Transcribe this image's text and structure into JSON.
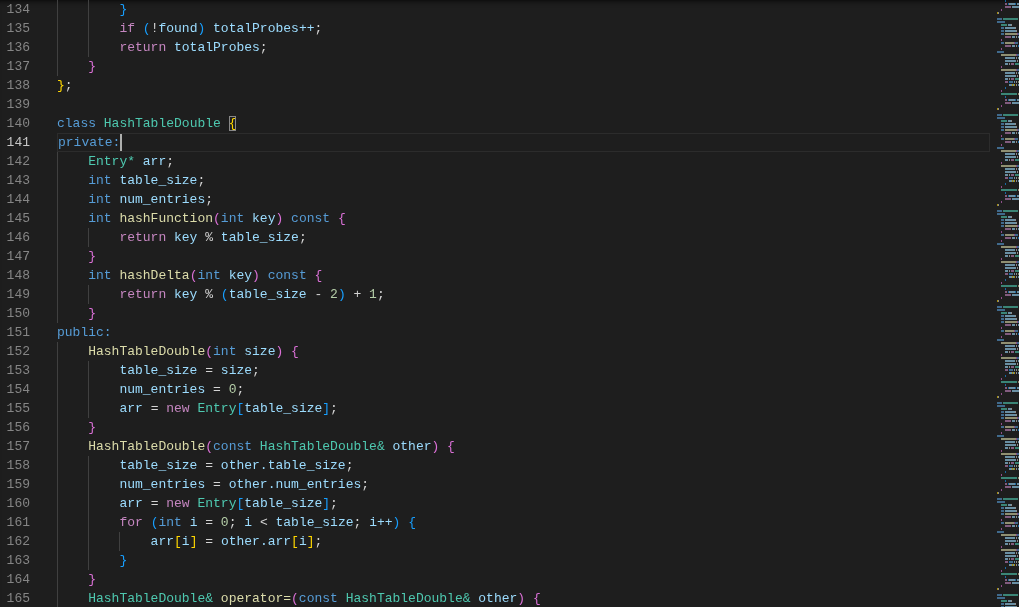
{
  "editor": {
    "lines": [
      {
        "number": "134",
        "current": false,
        "tokens": [
          {
            "text": "        }",
            "kind": "b3"
          }
        ]
      },
      {
        "number": "135",
        "current": false,
        "tokens": [
          {
            "text": "        if",
            "kind": "ctl"
          },
          {
            "text": " (",
            "kind": "b3"
          },
          {
            "text": "!",
            "kind": "plain"
          },
          {
            "text": "found",
            "kind": "var"
          },
          {
            "text": ")",
            "kind": "b3"
          },
          {
            "text": " totalProbes++",
            "kind": "var"
          },
          {
            "text": ";",
            "kind": "plain"
          }
        ]
      },
      {
        "number": "136",
        "current": false,
        "tokens": [
          {
            "text": "        return",
            "kind": "ctl"
          },
          {
            "text": " totalProbes",
            "kind": "var"
          },
          {
            "text": ";",
            "kind": "plain"
          }
        ]
      },
      {
        "number": "137",
        "current": false,
        "tokens": [
          {
            "text": "    }",
            "kind": "b2"
          }
        ]
      },
      {
        "number": "138",
        "current": false,
        "tokens": [
          {
            "text": "}",
            "kind": "b1"
          },
          {
            "text": ";",
            "kind": "plain"
          }
        ]
      },
      {
        "number": "139",
        "current": false
      },
      {
        "number": "140",
        "current": false,
        "tokens": [
          {
            "text": "class",
            "kind": "kw"
          },
          {
            "text": " HashTableDouble ",
            "kind": "type"
          },
          {
            "text": "{",
            "kind": "b1match"
          }
        ]
      },
      {
        "number": "141",
        "current": true,
        "tokens": [
          {
            "text": "private:",
            "kind": "kw"
          }
        ]
      },
      {
        "number": "142",
        "current": false,
        "tokens": [
          {
            "text": "    Entry*",
            "kind": "type"
          },
          {
            "text": " arr",
            "kind": "var"
          },
          {
            "text": ";",
            "kind": "plain"
          }
        ]
      },
      {
        "number": "143",
        "current": false,
        "tokens": [
          {
            "text": "    int",
            "kind": "kw"
          },
          {
            "text": " table_size",
            "kind": "var"
          },
          {
            "text": ";",
            "kind": "plain"
          }
        ]
      },
      {
        "number": "144",
        "current": false,
        "tokens": [
          {
            "text": "    int",
            "kind": "kw"
          },
          {
            "text": " num_entries",
            "kind": "var"
          },
          {
            "text": ";",
            "kind": "plain"
          }
        ]
      },
      {
        "number": "145",
        "current": false,
        "tokens": [
          {
            "text": "    int",
            "kind": "kw"
          },
          {
            "text": " hashFunction",
            "kind": "fn"
          },
          {
            "text": "(",
            "kind": "b2"
          },
          {
            "text": "int",
            "kind": "kw"
          },
          {
            "text": " key",
            "kind": "var"
          },
          {
            "text": ")",
            "kind": "b2"
          },
          {
            "text": " const",
            "kind": "kw"
          },
          {
            "text": " {",
            "kind": "b2"
          }
        ]
      },
      {
        "number": "146",
        "current": false,
        "tokens": [
          {
            "text": "        return",
            "kind": "ctl"
          },
          {
            "text": " key",
            "kind": "var"
          },
          {
            "text": " %",
            "kind": "plain"
          },
          {
            "text": " table_size",
            "kind": "var"
          },
          {
            "text": ";",
            "kind": "plain"
          }
        ]
      },
      {
        "number": "147",
        "current": false,
        "tokens": [
          {
            "text": "    }",
            "kind": "b2"
          }
        ]
      },
      {
        "number": "148",
        "current": false,
        "tokens": [
          {
            "text": "    int",
            "kind": "kw"
          },
          {
            "text": " hashDelta",
            "kind": "fn"
          },
          {
            "text": "(",
            "kind": "b2"
          },
          {
            "text": "int",
            "kind": "kw"
          },
          {
            "text": " key",
            "kind": "var"
          },
          {
            "text": ")",
            "kind": "b2"
          },
          {
            "text": " const",
            "kind": "kw"
          },
          {
            "text": " {",
            "kind": "b2"
          }
        ]
      },
      {
        "number": "149",
        "current": false,
        "tokens": [
          {
            "text": "        return",
            "kind": "ctl"
          },
          {
            "text": " key",
            "kind": "var"
          },
          {
            "text": " %",
            "kind": "plain"
          },
          {
            "text": " (",
            "kind": "b3"
          },
          {
            "text": "table_size",
            "kind": "var"
          },
          {
            "text": " -",
            "kind": "plain"
          },
          {
            "text": " 2",
            "kind": "num"
          },
          {
            "text": ")",
            "kind": "b3"
          },
          {
            "text": " +",
            "kind": "plain"
          },
          {
            "text": " 1",
            "kind": "num"
          },
          {
            "text": ";",
            "kind": "plain"
          }
        ]
      },
      {
        "number": "150",
        "current": false,
        "tokens": [
          {
            "text": "    }",
            "kind": "b2"
          }
        ]
      },
      {
        "number": "151",
        "current": false,
        "tokens": [
          {
            "text": "public:",
            "kind": "kw"
          }
        ]
      },
      {
        "number": "152",
        "current": false,
        "tokens": [
          {
            "text": "    HashTableDouble",
            "kind": "fn"
          },
          {
            "text": "(",
            "kind": "b2"
          },
          {
            "text": "int",
            "kind": "kw"
          },
          {
            "text": " size",
            "kind": "var"
          },
          {
            "text": ")",
            "kind": "b2"
          },
          {
            "text": " {",
            "kind": "b2"
          }
        ]
      },
      {
        "number": "153",
        "current": false,
        "tokens": [
          {
            "text": "        table_size",
            "kind": "var"
          },
          {
            "text": " =",
            "kind": "plain"
          },
          {
            "text": " size",
            "kind": "var"
          },
          {
            "text": ";",
            "kind": "plain"
          }
        ]
      },
      {
        "number": "154",
        "current": false,
        "tokens": [
          {
            "text": "        num_entries",
            "kind": "var"
          },
          {
            "text": " =",
            "kind": "plain"
          },
          {
            "text": " 0",
            "kind": "num"
          },
          {
            "text": ";",
            "kind": "plain"
          }
        ]
      },
      {
        "number": "155",
        "current": false,
        "tokens": [
          {
            "text": "        arr",
            "kind": "var"
          },
          {
            "text": " =",
            "kind": "plain"
          },
          {
            "text": " new",
            "kind": "ctl"
          },
          {
            "text": " Entry",
            "kind": "type"
          },
          {
            "text": "[",
            "kind": "b3"
          },
          {
            "text": "table_size",
            "kind": "var"
          },
          {
            "text": "]",
            "kind": "b3"
          },
          {
            "text": ";",
            "kind": "plain"
          }
        ]
      },
      {
        "number": "156",
        "current": false,
        "tokens": [
          {
            "text": "    }",
            "kind": "b2"
          }
        ]
      },
      {
        "number": "157",
        "current": false,
        "tokens": [
          {
            "text": "    HashTableDouble",
            "kind": "fn"
          },
          {
            "text": "(",
            "kind": "b2"
          },
          {
            "text": "const",
            "kind": "kw"
          },
          {
            "text": " HashTableDouble&",
            "kind": "type"
          },
          {
            "text": " other",
            "kind": "var"
          },
          {
            "text": ")",
            "kind": "b2"
          },
          {
            "text": " {",
            "kind": "b2"
          }
        ]
      },
      {
        "number": "158",
        "current": false,
        "tokens": [
          {
            "text": "        table_size",
            "kind": "var"
          },
          {
            "text": " =",
            "kind": "plain"
          },
          {
            "text": " other.table_size",
            "kind": "var"
          },
          {
            "text": ";",
            "kind": "plain"
          }
        ]
      },
      {
        "number": "159",
        "current": false,
        "tokens": [
          {
            "text": "        num_entries",
            "kind": "var"
          },
          {
            "text": " =",
            "kind": "plain"
          },
          {
            "text": " other.num_entries",
            "kind": "var"
          },
          {
            "text": ";",
            "kind": "plain"
          }
        ]
      },
      {
        "number": "160",
        "current": false,
        "tokens": [
          {
            "text": "        arr",
            "kind": "var"
          },
          {
            "text": " =",
            "kind": "plain"
          },
          {
            "text": " new",
            "kind": "ctl"
          },
          {
            "text": " Entry",
            "kind": "type"
          },
          {
            "text": "[",
            "kind": "b3"
          },
          {
            "text": "table_size",
            "kind": "var"
          },
          {
            "text": "]",
            "kind": "b3"
          },
          {
            "text": ";",
            "kind": "plain"
          }
        ]
      },
      {
        "number": "161",
        "current": false,
        "tokens": [
          {
            "text": "        for",
            "kind": "ctl"
          },
          {
            "text": " (",
            "kind": "b3"
          },
          {
            "text": "int",
            "kind": "kw"
          },
          {
            "text": " i",
            "kind": "var"
          },
          {
            "text": " =",
            "kind": "plain"
          },
          {
            "text": " 0",
            "kind": "num"
          },
          {
            "text": ";",
            "kind": "plain"
          },
          {
            "text": " i",
            "kind": "var"
          },
          {
            "text": " <",
            "kind": "plain"
          },
          {
            "text": " table_size",
            "kind": "var"
          },
          {
            "text": ";",
            "kind": "plain"
          },
          {
            "text": " i++",
            "kind": "var"
          },
          {
            "text": ")",
            "kind": "b3"
          },
          {
            "text": " {",
            "kind": "b3"
          }
        ]
      },
      {
        "number": "162",
        "current": false,
        "tokens": [
          {
            "text": "            arr",
            "kind": "var"
          },
          {
            "text": "[",
            "kind": "b1"
          },
          {
            "text": "i",
            "kind": "var"
          },
          {
            "text": "]",
            "kind": "b1"
          },
          {
            "text": " =",
            "kind": "plain"
          },
          {
            "text": " other.arr",
            "kind": "var"
          },
          {
            "text": "[",
            "kind": "b1"
          },
          {
            "text": "i",
            "kind": "var"
          },
          {
            "text": "]",
            "kind": "b1"
          },
          {
            "text": ";",
            "kind": "plain"
          }
        ]
      },
      {
        "number": "163",
        "current": false,
        "tokens": [
          {
            "text": "        }",
            "kind": "b3"
          }
        ]
      },
      {
        "number": "164",
        "current": false,
        "tokens": [
          {
            "text": "    }",
            "kind": "b2"
          }
        ]
      },
      {
        "number": "165",
        "current": false,
        "tokens": [
          {
            "text": "    HashTableDouble&",
            "kind": "type"
          },
          {
            "text": " operator=",
            "kind": "fn"
          },
          {
            "text": "(",
            "kind": "b2"
          },
          {
            "text": "const",
            "kind": "kw"
          },
          {
            "text": " HashTableDouble&",
            "kind": "type"
          },
          {
            "text": " other",
            "kind": "var"
          },
          {
            "text": ")",
            "kind": "b2"
          },
          {
            "text": " {",
            "kind": "b2"
          }
        ]
      }
    ]
  }
}
